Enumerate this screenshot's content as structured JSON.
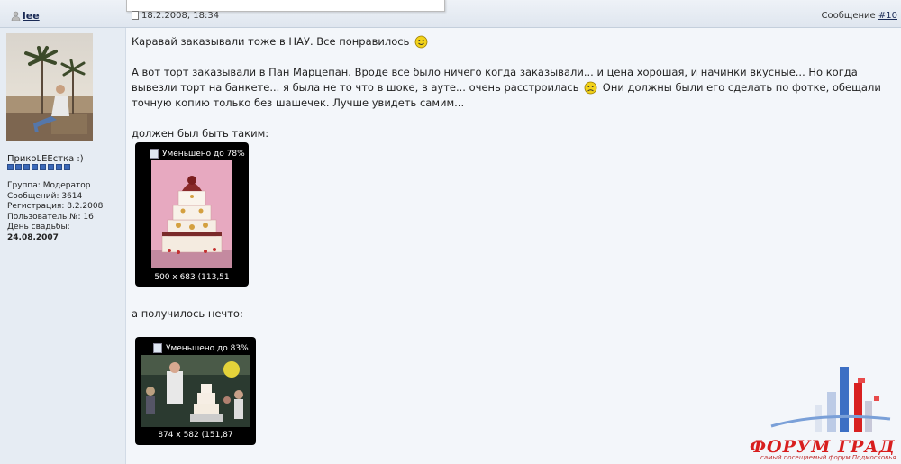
{
  "post": {
    "author": "lee",
    "date": "18.2.2008, 18:34",
    "number_prefix": "Сообщение",
    "number_link": "#10"
  },
  "user": {
    "nick": "ПрикоLEEстка :)",
    "group": "Группа: Модератор",
    "messages": "Сообщений: 3614",
    "registered": "Регистрация: 8.2.2008",
    "user_no": "Пользователь №: 16",
    "wedding_label": "День свадьбы:",
    "wedding_date": "24.08.2007"
  },
  "message": {
    "p1": "Каравай заказывали тоже в НАУ. Все понравилось",
    "p2a": "А вот торт заказывали в Пан Марцепан. Вроде все было ничего когда заказывали... и цена хорошая, и начинки вкусные... Но когда вывезли торт на банкете... я была не то что в шоке, в ауте... очень расстроилась",
    "p2b": "Они должны были его сделать по фотке, обещали точную копию только без шашечек. Лучше увидеть самим...",
    "p3": "должен был быть таким:",
    "p4": "а получилось нечто:"
  },
  "images": [
    {
      "label": "Уменьшено до 78%",
      "dims": "500 x 683 (113,51"
    },
    {
      "label": "Уменьшено до 83%",
      "dims": "874 x 582 (151,87"
    }
  ],
  "watermark": {
    "title": "ФОРУМ ГРАД",
    "subtitle": "самый посещаемый форум Подмосковья"
  },
  "colors": {
    "accent": "#1a2a55",
    "logo_red": "#d81e1e",
    "sidebar": "#e6ecf3"
  }
}
